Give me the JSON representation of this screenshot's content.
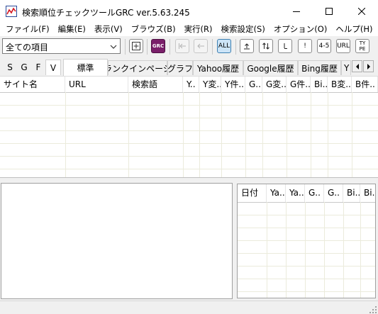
{
  "window": {
    "title": "検索順位チェックツールGRC  ver.5.63.245",
    "controls": {
      "minimize": "minimize",
      "maximize": "maximize",
      "close": "close"
    }
  },
  "menu": [
    "ファイル(F)",
    "編集(E)",
    "表示(V)",
    "ブラウズ(B)",
    "実行(R)",
    "検索設定(S)",
    "オプション(O)",
    "ヘルプ(H)"
  ],
  "toolbar": {
    "filter_value": "全ての項目",
    "buttons": [
      {
        "id": "add",
        "label": "+"
      },
      {
        "id": "grc",
        "label": "GRC"
      },
      {
        "id": "first",
        "label": "|←"
      },
      {
        "id": "back",
        "label": "←"
      },
      {
        "id": "all",
        "label": "ALL"
      },
      {
        "id": "up",
        "label": "↥"
      },
      {
        "id": "updown",
        "label": "⇅"
      },
      {
        "id": "down",
        "label": "↓"
      },
      {
        "id": "alert",
        "label": "!"
      },
      {
        "id": "range",
        "label": "4-5"
      },
      {
        "id": "url",
        "label": "URL"
      },
      {
        "id": "type",
        "label": "TY PE"
      }
    ]
  },
  "view_tabs": [
    "S",
    "G",
    "F",
    "V"
  ],
  "tabs": [
    "標準",
    "ランクインページ",
    "グラフ",
    "Yahoo履歴",
    "Google履歴",
    "Bing履歴",
    "Y"
  ],
  "main_table": {
    "columns": [
      "サイト名",
      "URL",
      "検索語",
      "Y..",
      "Y変..",
      "Y件..",
      "G..",
      "G変..",
      "G件..",
      "Bi..",
      "B変..",
      "B件.."
    ]
  },
  "history_table": {
    "columns": [
      "日付",
      "Ya..",
      "Ya..",
      "G..",
      "G..",
      "Bi..",
      "Bi.."
    ]
  },
  "colors": {
    "accent": "#cce4f7",
    "grc_brand": "#7a1f6a"
  }
}
